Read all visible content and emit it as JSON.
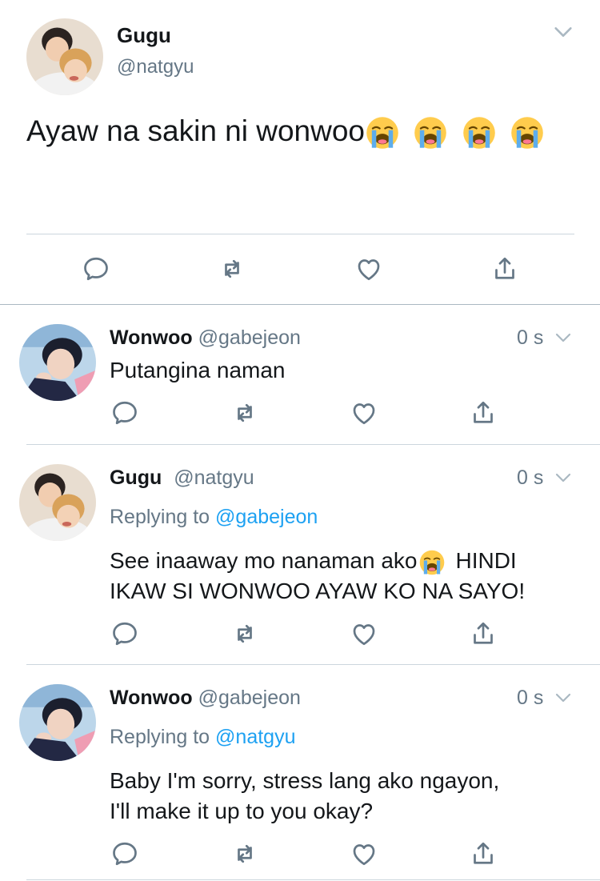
{
  "main_tweet": {
    "display_name": "Gugu",
    "handle": "@natgyu",
    "text": "Ayaw na sakin ni wonwoo",
    "emoji_count": 4,
    "emoji_name": "loudly-crying-face"
  },
  "replies": [
    {
      "display_name": "Wonwoo",
      "handle": "@gabejeon",
      "time": "0 s",
      "replying_label": "",
      "replying_to": "",
      "text_lines": [
        "Putangina naman"
      ]
    },
    {
      "display_name": "Gugu",
      "handle": "@natgyu",
      "time": "0 s",
      "replying_label": "Replying to",
      "replying_to": "@gabejeon",
      "text_before_emoji": "See inaaway mo nanaman ako",
      "text_after_emoji": "HINDI",
      "text_line2": "IKAW SI WONWOO AYAW KO NA SAYO!"
    },
    {
      "display_name": "Wonwoo",
      "handle": "@gabejeon",
      "time": "0 s",
      "replying_label": "Replying to",
      "replying_to": "@natgyu",
      "text_lines": [
        "Baby I'm sorry, stress lang ako ngayon,",
        "I'll make it up to you okay?"
      ]
    }
  ],
  "colors": {
    "text": "#14171a",
    "muted": "#657786",
    "link": "#1da1f2",
    "divider": "#ccd6dd"
  }
}
